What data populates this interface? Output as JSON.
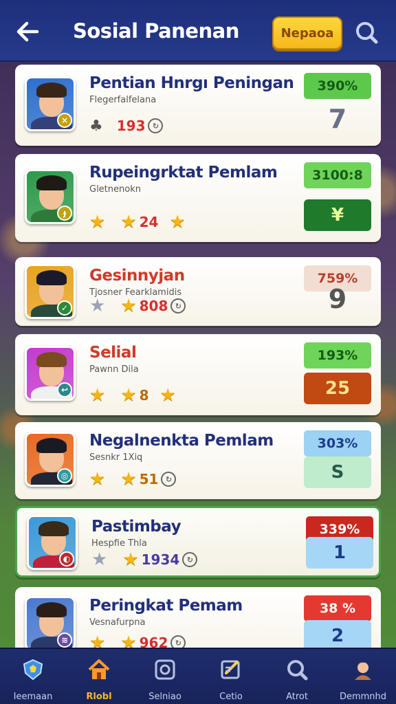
{
  "header": {
    "title": "Sosial Panenan",
    "action_label": "Nepaoa"
  },
  "players": [
    {
      "name": "Pentian Hnrgı Peningan",
      "subtitle": "Flegerfalfelana",
      "stat": "193",
      "percent": "390%",
      "rank": "7",
      "name_color": "#22307a",
      "stat_color": "#d43030",
      "stars": 0,
      "pct_bg": "#5cc94a",
      "pct_fg": "#145a14",
      "rank_bg": "transparent",
      "rank_fg": "#6a7088"
    },
    {
      "name": "Rupeingrktat Pemlam",
      "subtitle": "Gletnenokn",
      "stat": "24",
      "percent": "3100:8",
      "rank": "¥",
      "name_color": "#22307a",
      "stat_color": "#d43030",
      "stars": 3,
      "pct_bg": "#6fd45a",
      "pct_fg": "#145a14",
      "rank_bg": "#1f7a2c",
      "rank_fg": "#e9ff9a"
    },
    {
      "name": "Gesinnyjan",
      "subtitle": "Tjosner Fearklamidis",
      "stat": "808",
      "percent": "759%",
      "rank": "9",
      "name_color": "#cf3a2a",
      "stat_color": "#d43030",
      "stars": 2,
      "pct_bg": "#f2ddd2",
      "pct_fg": "#b54030",
      "rank_bg": "transparent",
      "rank_fg": "#555"
    },
    {
      "name": "Selial",
      "subtitle": "Pawnn Dila",
      "stat": "8",
      "percent": "193%",
      "rank": "25",
      "name_color": "#cf3a2a",
      "stat_color": "#c06a00",
      "stars": 3,
      "pct_bg": "#6fd45a",
      "pct_fg": "#145a14",
      "rank_bg": "#c04a12",
      "rank_fg": "#ffe08a"
    },
    {
      "name": "Negalnenkta Pemlam",
      "subtitle": "Sesnkr 1Xiq",
      "stat": "51",
      "percent": "303%",
      "rank": "S",
      "name_color": "#22307a",
      "stat_color": "#c06a00",
      "stars": 2,
      "pct_bg": "#9cd2f3",
      "pct_fg": "#1c3a8c",
      "rank_bg": "#bfeccc",
      "rank_fg": "#2a5a4a"
    },
    {
      "name": "Pastimbay",
      "subtitle": "Hespfie Thla",
      "stat": "1934",
      "percent": "339%",
      "rank": "1",
      "name_color": "#22307a",
      "stat_color": "#4a3aa0",
      "stars": 1,
      "pct_bg": "#c8281e",
      "pct_fg": "#ffffff",
      "rank_bg": "#a6d6f6",
      "rank_fg": "#1c3a8c"
    },
    {
      "name": "Peringkat Pemam",
      "subtitle": "Vesnafurpna",
      "stat": "962",
      "percent": "38 %",
      "rank": "2",
      "name_color": "#22307a",
      "stat_color": "#d43030",
      "stars": 2,
      "pct_bg": "#e23a30",
      "pct_fg": "#ffffff",
      "rank_bg": "#a6d6f6",
      "rank_fg": "#1c3a8c"
    }
  ],
  "nav": [
    {
      "label": "Ieemaan",
      "icon": "shield-icon",
      "active": false
    },
    {
      "label": "Rlobl",
      "icon": "home-icon",
      "active": true
    },
    {
      "label": "Selniao",
      "icon": "settings-icon",
      "active": false
    },
    {
      "label": "Cetio",
      "icon": "edit-icon",
      "active": false
    },
    {
      "label": "Atrot",
      "icon": "search-icon",
      "active": false
    },
    {
      "label": "Demmnhd",
      "icon": "profile-icon",
      "active": false
    }
  ]
}
